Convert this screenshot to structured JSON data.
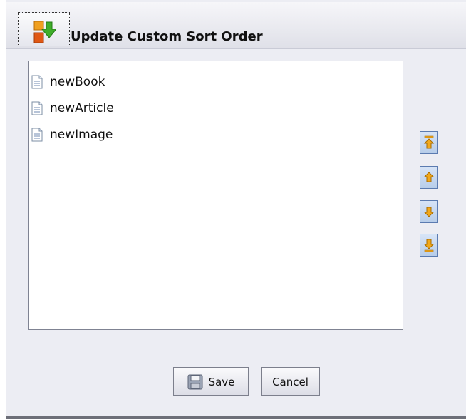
{
  "dialog": {
    "title": "Update Custom Sort Order",
    "title_icon": "sort-order-icon"
  },
  "list": {
    "items": [
      {
        "label": "newBook",
        "icon": "document-icon"
      },
      {
        "label": "newArticle",
        "icon": "document-icon"
      },
      {
        "label": "newImage",
        "icon": "document-icon"
      }
    ]
  },
  "side_buttons": {
    "move_top_icon": "move-to-top-icon",
    "move_up_icon": "move-up-icon",
    "move_down_icon": "move-down-icon",
    "move_bottom_icon": "move-to-bottom-icon"
  },
  "buttons": {
    "save_label": "Save",
    "cancel_label": "Cancel"
  },
  "colors": {
    "arrow": "#f2a91c",
    "button_border": "#5b7bb0",
    "button_fill": "#c8d9f1"
  }
}
